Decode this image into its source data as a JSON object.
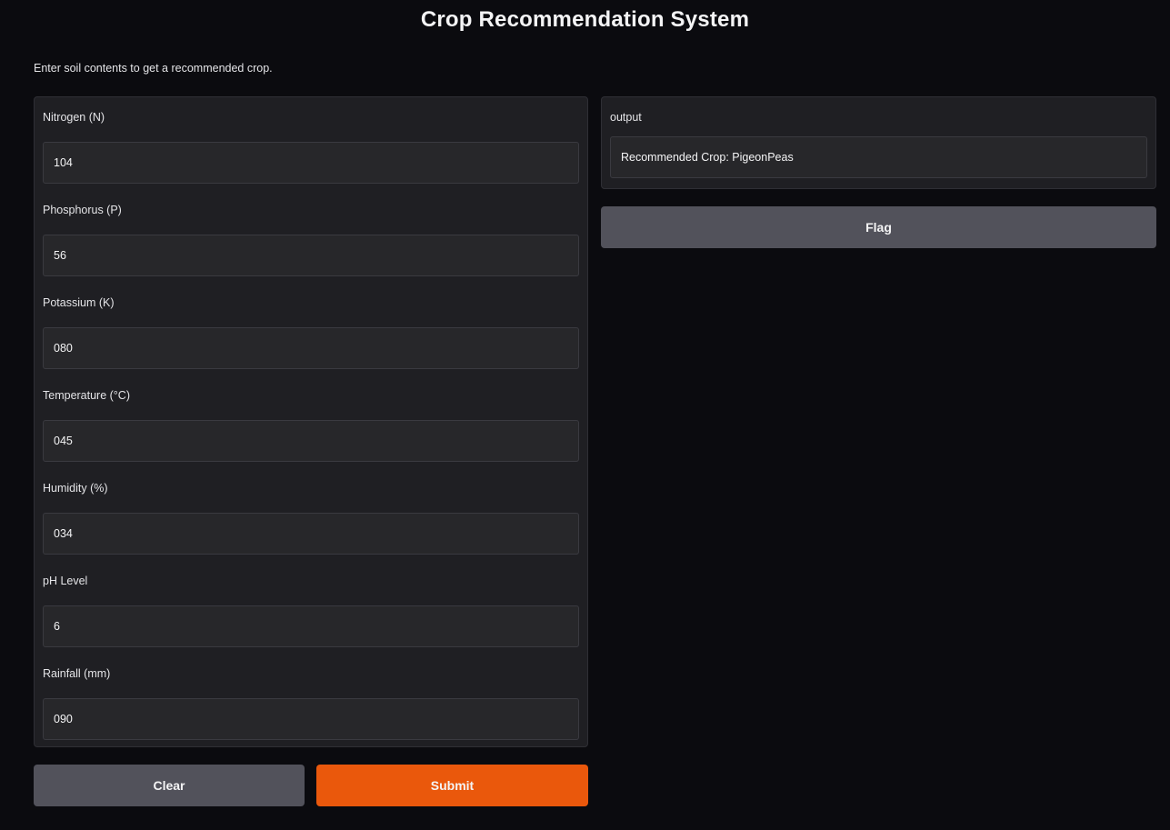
{
  "header": {
    "title": "Crop Recommendation System",
    "description": "Enter soil contents to get a recommended crop."
  },
  "inputs": [
    {
      "label": "Nitrogen (N)",
      "value": "104"
    },
    {
      "label": "Phosphorus (P)",
      "value": "56"
    },
    {
      "label": "Potassium (K)",
      "value": "080"
    },
    {
      "label": "Temperature (°C)",
      "value": "045"
    },
    {
      "label": "Humidity (%)",
      "value": "034"
    },
    {
      "label": "pH Level",
      "value": "6"
    },
    {
      "label": "Rainfall (mm)",
      "value": "090"
    }
  ],
  "output": {
    "label": "output",
    "value": "Recommended Crop: PigeonPeas"
  },
  "buttons": {
    "flag": "Flag",
    "clear": "Clear",
    "submit": "Submit"
  },
  "colors": {
    "background": "#0b0b0f",
    "panel": "#1f1f23",
    "input": "#27272a",
    "secondary_button": "#52525b",
    "primary_button": "#ea580c"
  }
}
